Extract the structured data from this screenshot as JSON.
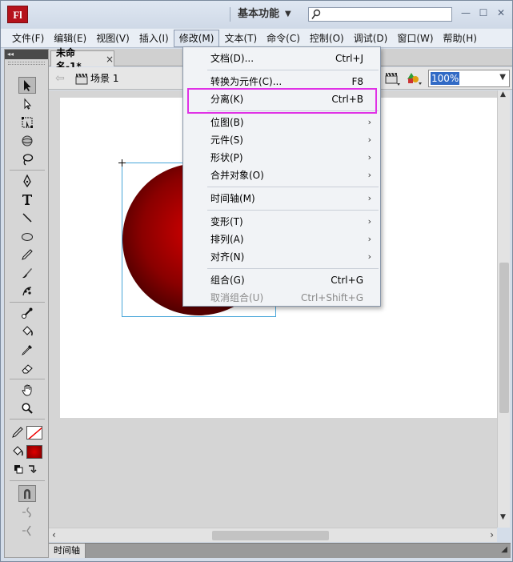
{
  "app": {
    "logo_text": "Fl",
    "workspace": "基本功能",
    "search_placeholder": ""
  },
  "menubar": [
    "文件(F)",
    "编辑(E)",
    "视图(V)",
    "插入(I)",
    "修改(M)",
    "文本(T)",
    "命令(C)",
    "控制(O)",
    "调试(D)",
    "窗口(W)",
    "帮助(H)"
  ],
  "document": {
    "tab_title": "未命名-1*",
    "tab_close": "×",
    "scene_label": "场景 1",
    "zoom": "100%"
  },
  "timeline": {
    "label": "时间轴"
  },
  "colors": {
    "accent_highlight": "#e031e6",
    "selection_blue": "#46a5d9",
    "fill_color": "#cc0000",
    "logo_red": "#b5121b"
  },
  "modify_menu": {
    "items": [
      {
        "label": "文档(D)...",
        "shortcut": "Ctrl+J"
      },
      {
        "label": "转换为元件(C)...",
        "shortcut": "F8"
      },
      {
        "label": "分离(K)",
        "shortcut": "Ctrl+B"
      },
      {
        "label": "位图(B)",
        "submenu": true
      },
      {
        "label": "元件(S)",
        "submenu": true
      },
      {
        "label": "形状(P)",
        "submenu": true
      },
      {
        "label": "合并对象(O)",
        "submenu": true
      },
      {
        "label": "时间轴(M)",
        "submenu": true
      },
      {
        "label": "变形(T)",
        "submenu": true
      },
      {
        "label": "排列(A)",
        "submenu": true
      },
      {
        "label": "对齐(N)",
        "submenu": true
      },
      {
        "label": "组合(G)",
        "shortcut": "Ctrl+G"
      },
      {
        "label": "取消组合(U)",
        "shortcut": "Ctrl+Shift+G",
        "disabled": true
      }
    ]
  },
  "icons": {
    "toolbar": [
      "selection-tool-icon",
      "subselection-tool-icon",
      "free-transform-tool-icon",
      "3d-rotation-tool-icon",
      "lasso-tool-icon",
      "pen-tool-icon",
      "text-tool-icon",
      "line-tool-icon",
      "oval-tool-icon",
      "pencil-tool-icon",
      "brush-tool-icon",
      "deco-tool-icon",
      "bone-tool-icon",
      "paint-bucket-tool-icon",
      "eyedropper-tool-icon",
      "eraser-tool-icon",
      "hand-tool-icon",
      "zoom-tool-icon",
      "stroke-color-icon",
      "fill-color-icon",
      "swap-colors-icon",
      "snap-to-objects-icon",
      "smooth-icon",
      "straighten-icon"
    ]
  }
}
